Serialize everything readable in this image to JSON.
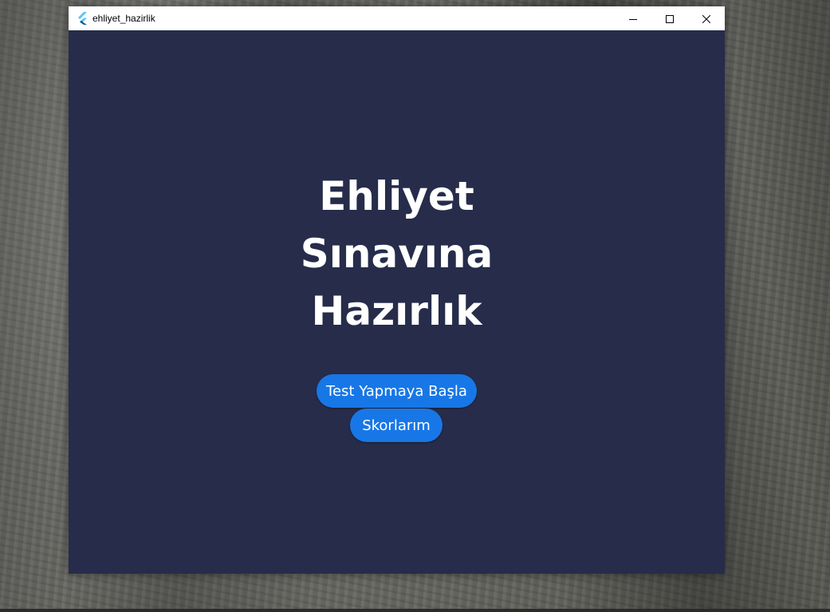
{
  "window": {
    "title": "ehliyet_hazirlik",
    "icon": "flutter-logo-icon",
    "controls": [
      "minimize-icon",
      "maximize-icon",
      "close-icon"
    ]
  },
  "main": {
    "heading_lines": [
      "Ehliyet",
      "Sınavına",
      "Hazırlık"
    ],
    "start_test_label": "Test Yapmaya Başla",
    "scores_label": "Skorlarım"
  },
  "colors": {
    "background": "#262c4a",
    "button": "#1877e6",
    "text": "#ffffff"
  }
}
